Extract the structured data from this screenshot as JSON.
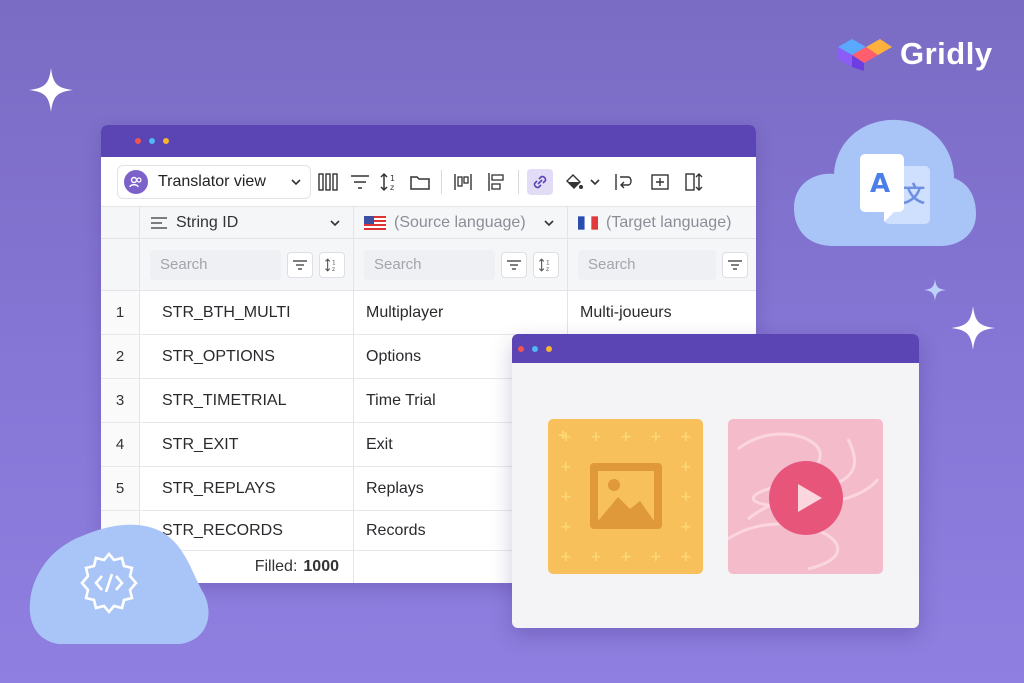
{
  "brand": {
    "name": "Gridly"
  },
  "colors": {
    "accent": "#5b44b3",
    "dot_red": "#f0544f",
    "dot_blue": "#4db8f2",
    "dot_yellow": "#f5b52f",
    "cloud": "#a9c4f7"
  },
  "toolbar": {
    "view_label": "Translator view",
    "icons": [
      "columns-icon",
      "filter-icon",
      "sort-icon",
      "folder-icon",
      "layout-icon",
      "align-icon",
      "link-icon",
      "paint-bucket-icon",
      "wrap-icon",
      "add-box-icon",
      "column-height-icon"
    ]
  },
  "grid": {
    "columns": [
      {
        "label": "String ID",
        "icon": "text-lines-icon",
        "muted": false
      },
      {
        "label": "(Source language)",
        "icon": "us-flag-icon",
        "muted": true
      },
      {
        "label": "(Target language)",
        "icon": "fr-flag-icon",
        "muted": true
      }
    ],
    "search_placeholder": "Search",
    "rows": [
      {
        "num": "1",
        "id": "STR_BTH_MULTI",
        "source": "Multiplayer",
        "target": "Multi-joueurs"
      },
      {
        "num": "2",
        "id": "STR_OPTIONS",
        "source": "Options",
        "target": ""
      },
      {
        "num": "3",
        "id": "STR_TIMETRIAL",
        "source": "Time Trial",
        "target": ""
      },
      {
        "num": "4",
        "id": "STR_EXIT",
        "source": "Exit",
        "target": ""
      },
      {
        "num": "5",
        "id": "STR_REPLAYS",
        "source": "Replays",
        "target": ""
      },
      {
        "num": "",
        "id": "STR_RECORDS",
        "source": "Records",
        "target": ""
      }
    ],
    "footer": {
      "filled_label": "Filled:",
      "filled_value": "1000"
    }
  },
  "media_window": {
    "tiles": [
      {
        "kind": "image",
        "icon": "image-icon"
      },
      {
        "kind": "video",
        "icon": "play-icon"
      }
    ]
  },
  "decor_icons": [
    "translate-icon",
    "code-gear-icon",
    "sparkle-icon"
  ]
}
